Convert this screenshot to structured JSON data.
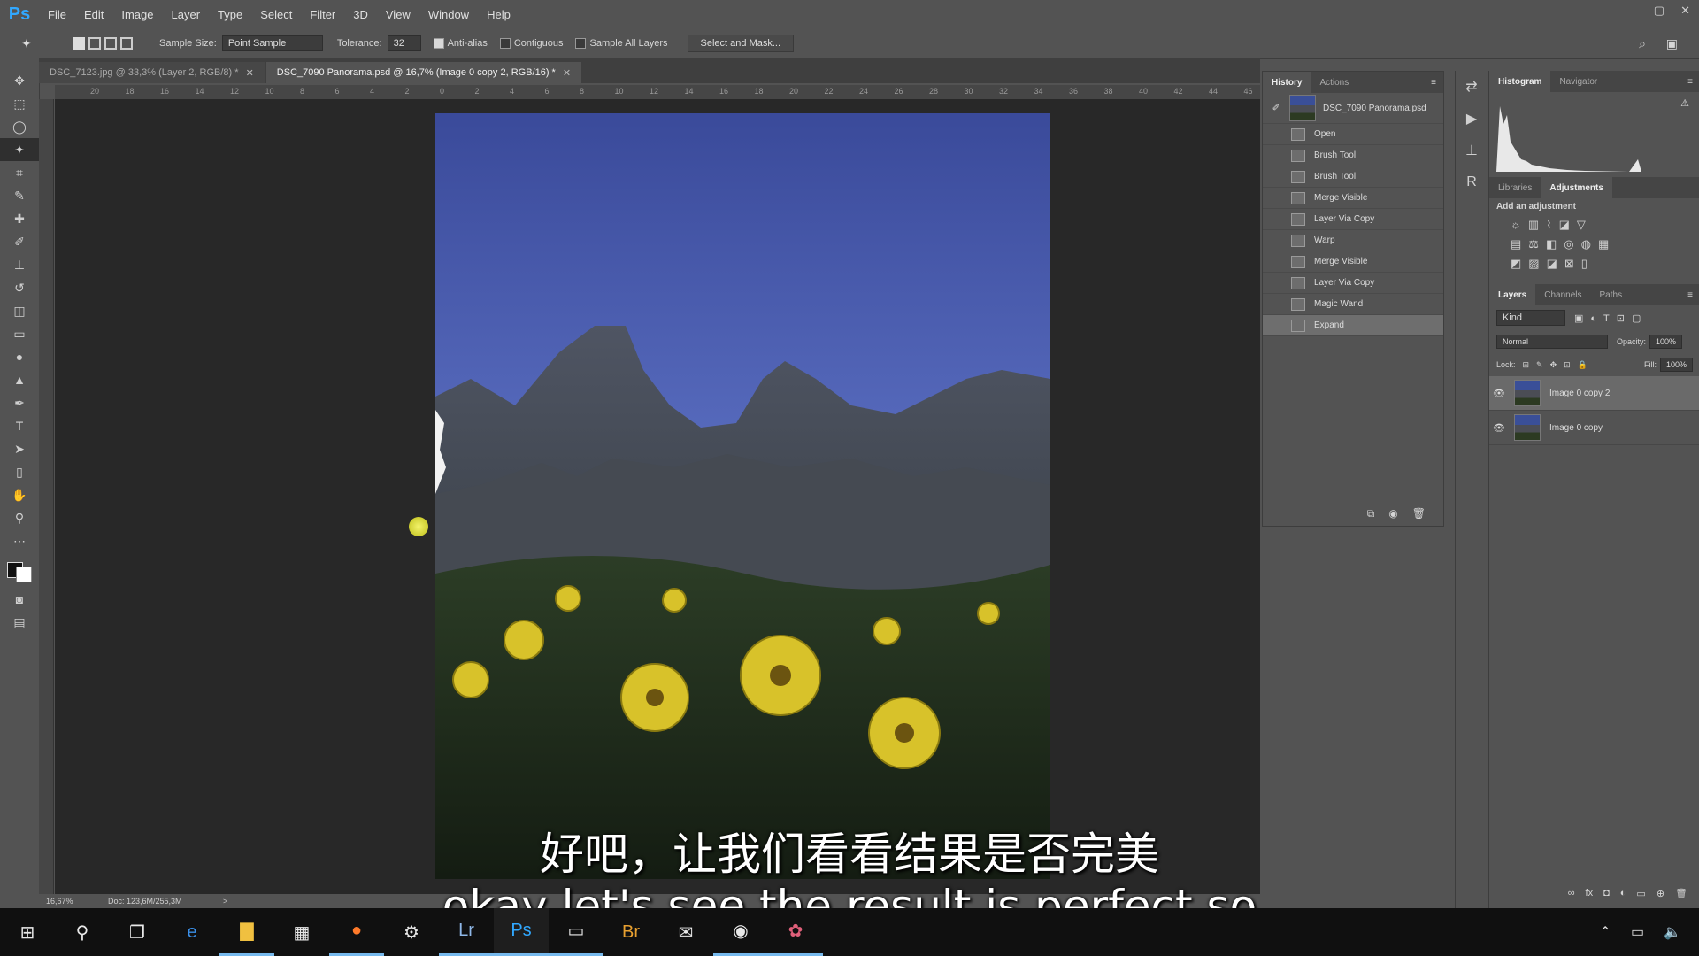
{
  "app": {
    "logo": "Ps",
    "menu": [
      "File",
      "Edit",
      "Image",
      "Layer",
      "Type",
      "Select",
      "Filter",
      "3D",
      "View",
      "Window",
      "Help"
    ]
  },
  "window_controls": [
    "–",
    "▢",
    "✕"
  ],
  "options_bar": {
    "sample_size_label": "Sample Size:",
    "sample_size_value": "Point Sample",
    "tolerance_label": "Tolerance:",
    "tolerance_value": "32",
    "anti_alias": "Anti-alias",
    "anti_alias_checked": true,
    "contiguous": "Contiguous",
    "contiguous_checked": false,
    "sample_all_layers": "Sample All Layers",
    "sample_all_layers_checked": false,
    "select_and_mask": "Select and Mask..."
  },
  "tabs": [
    {
      "label": "DSC_7123.jpg @ 33,3% (Layer 2, RGB/8) *",
      "active": false
    },
    {
      "label": "DSC_7090 Panorama.psd @ 16,7% (Image 0 copy 2, RGB/16) *",
      "active": true
    }
  ],
  "ruler_ticks": [
    "20",
    "18",
    "16",
    "14",
    "12",
    "10",
    "8",
    "6",
    "4",
    "2",
    "0",
    "2",
    "4",
    "6",
    "8",
    "10",
    "12",
    "14",
    "16",
    "18",
    "20",
    "22",
    "24",
    "26",
    "28",
    "30",
    "32",
    "34",
    "36",
    "38",
    "40",
    "42",
    "44",
    "46"
  ],
  "status": {
    "zoom": "16,67%",
    "doc": "Doc: 123,6M/255,3M",
    "arrow": ">"
  },
  "history": {
    "tabs": [
      "History",
      "Actions"
    ],
    "snapshot": "DSC_7090 Panorama.psd",
    "items": [
      "Open",
      "Brush Tool",
      "Brush Tool",
      "Merge Visible",
      "Layer Via Copy",
      "Warp",
      "Merge Visible",
      "Layer Via Copy",
      "Magic Wand",
      "Expand"
    ],
    "selected_index": 9
  },
  "histogram": {
    "tabs": [
      "Histogram",
      "Navigator"
    ]
  },
  "adjustments": {
    "tabs": [
      "Libraries",
      "Adjustments"
    ],
    "add_label": "Add an adjustment"
  },
  "layers": {
    "tabs": [
      "Layers",
      "Channels",
      "Paths"
    ],
    "kind": "Kind",
    "blend_mode": "Normal",
    "opacity_label": "Opacity:",
    "opacity_value": "100%",
    "lock_label": "Lock:",
    "fill_label": "Fill:",
    "fill_value": "100%",
    "items": [
      {
        "name": "Image 0 copy 2",
        "selected": true
      },
      {
        "name": "Image 0 copy",
        "selected": false
      }
    ]
  },
  "subtitles": {
    "chinese": "好吧，让我们看看结果是否完美",
    "english": "okay let's see the result is perfect so"
  },
  "colors": {
    "ps_blue": "#31a8ff",
    "sky_top": "#3a4a9a",
    "flower": "#d8c22a"
  }
}
